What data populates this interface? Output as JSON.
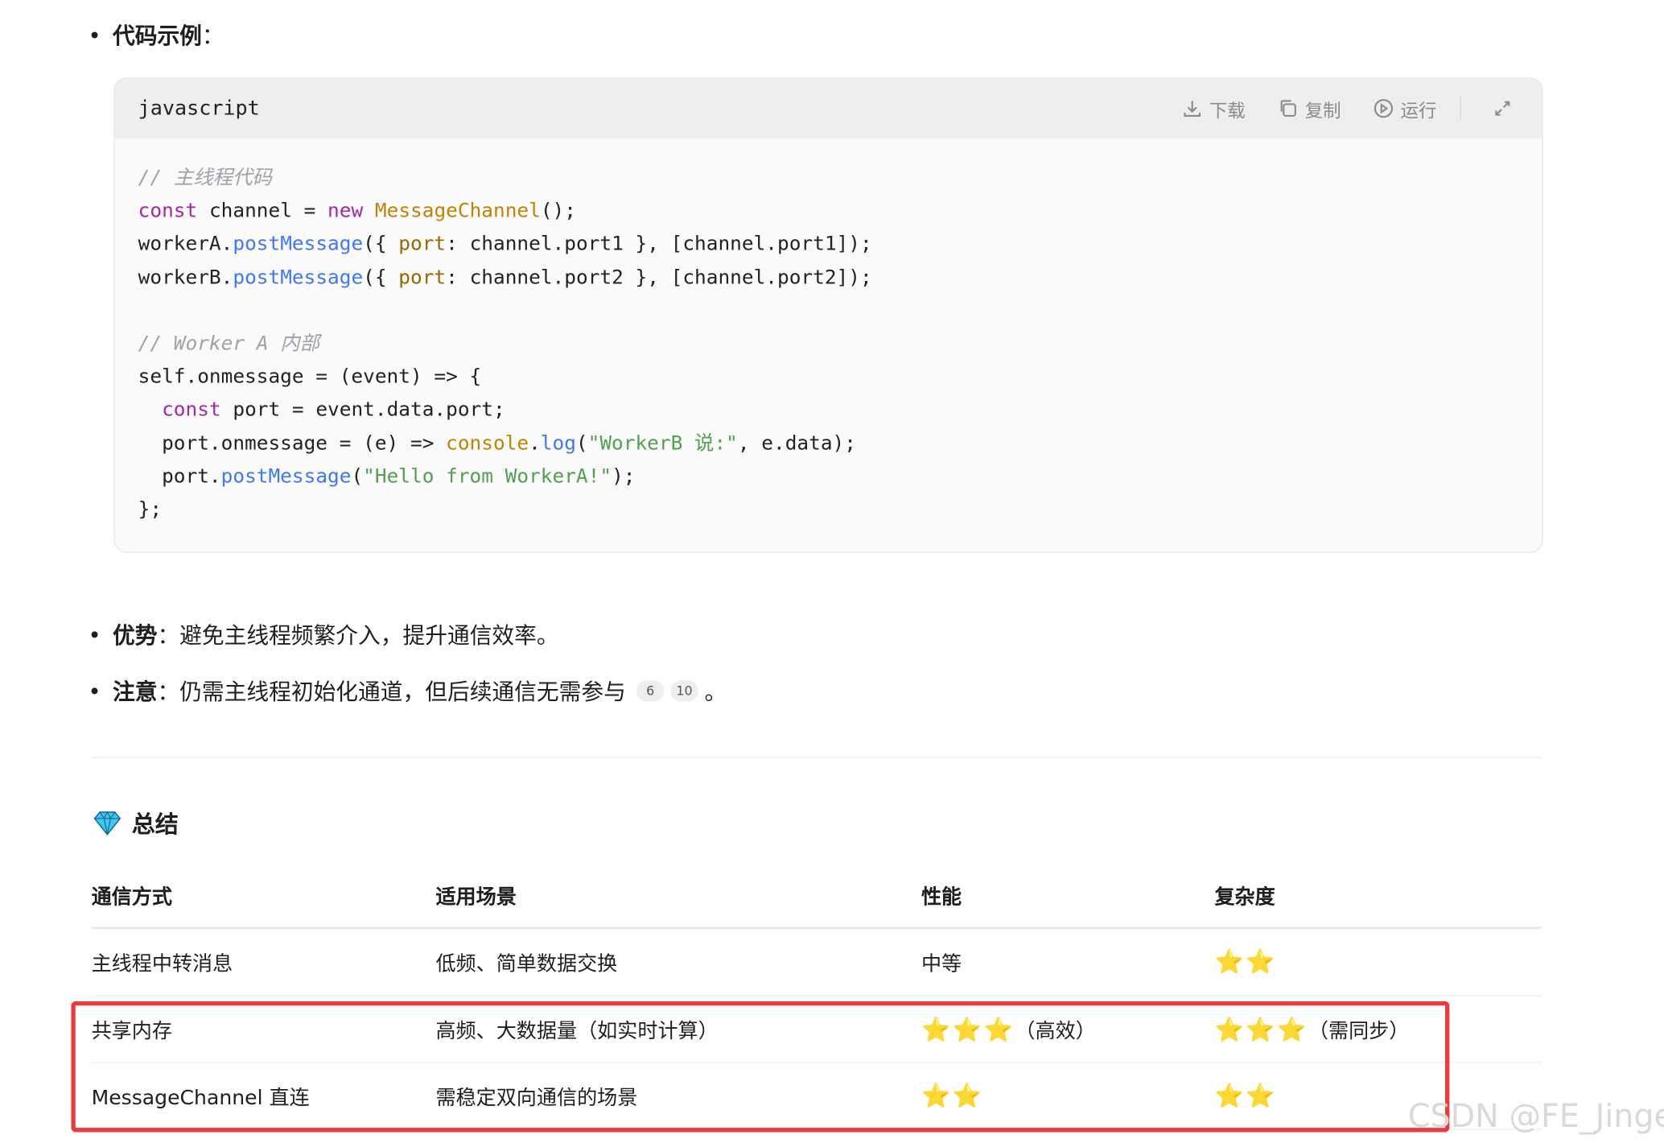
{
  "sections": {
    "code_example_label": "代码示例",
    "advantage_label": "优势",
    "advantage_text": "：避免主线程频繁介入，提升通信效率。",
    "note_label": "注意",
    "note_text": "：仍需主线程初始化通道，但后续通信无需参与",
    "note_cites": [
      "6",
      "10"
    ],
    "note_end": "。"
  },
  "code_block": {
    "language": "javascript",
    "download_label": "下载",
    "copy_label": "复制",
    "run_label": "运行",
    "comment1": "// 主线程代码",
    "comment2": "// Worker A 内部"
  },
  "summary": {
    "title": "总结",
    "headers": [
      "通信方式",
      "适用场景",
      "性能",
      "复杂度"
    ],
    "rows": [
      {
        "method": "主线程中转消息",
        "scene": "低频、简单数据交换",
        "perf": "中等",
        "perf_note": "",
        "complexity_stars": "⭐⭐",
        "complexity_note": ""
      },
      {
        "method": "共享内存",
        "scene": "高频、大数据量（如实时计算）",
        "perf": "⭐⭐⭐",
        "perf_note": "（高效）",
        "complexity_stars": "⭐⭐⭐",
        "complexity_note": "（需同步）"
      },
      {
        "method": "MessageChannel 直连",
        "scene": "需稳定双向通信的场景",
        "perf": "⭐⭐",
        "perf_note": "",
        "complexity_stars": "⭐⭐",
        "complexity_note": ""
      }
    ]
  },
  "watermark": "CSDN @FE_Jinger",
  "colors": {
    "highlight_border": "#ee3a3a",
    "star": "#f4b400"
  }
}
